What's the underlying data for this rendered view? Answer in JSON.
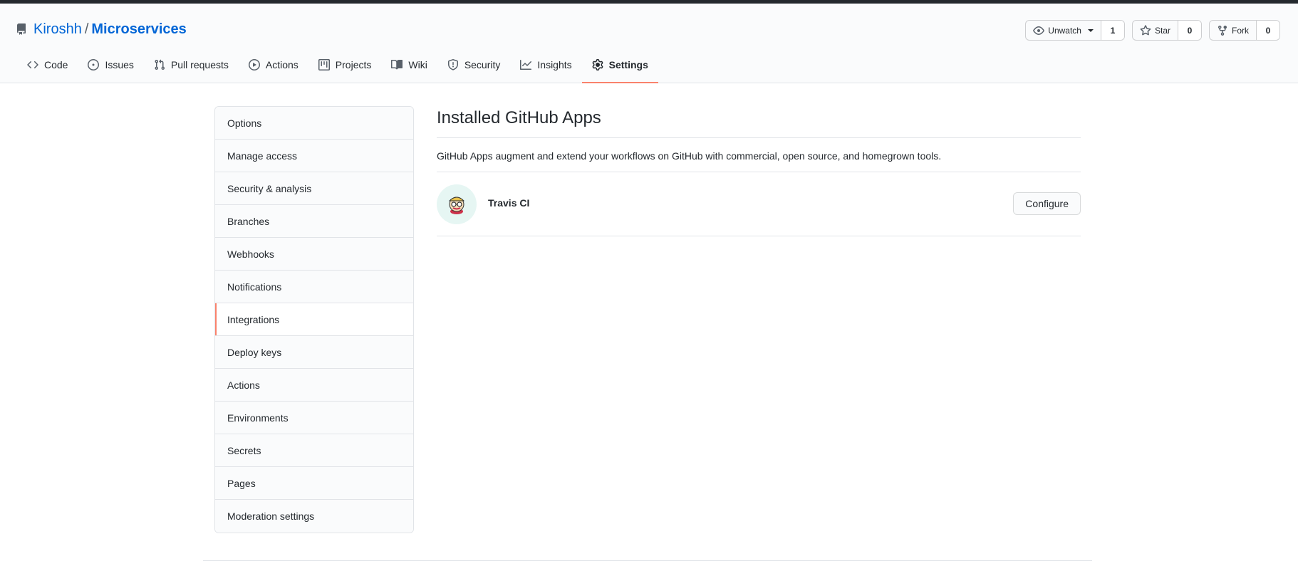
{
  "repo": {
    "owner": "Kiroshh",
    "separator": "/",
    "name": "Microservices"
  },
  "header_actions": {
    "watch": {
      "label": "Unwatch",
      "count": "1"
    },
    "star": {
      "label": "Star",
      "count": "0"
    },
    "fork": {
      "label": "Fork",
      "count": "0"
    }
  },
  "tabs": [
    {
      "label": "Code",
      "icon": "code-icon"
    },
    {
      "label": "Issues",
      "icon": "issue-icon"
    },
    {
      "label": "Pull requests",
      "icon": "pull-request-icon"
    },
    {
      "label": "Actions",
      "icon": "play-icon"
    },
    {
      "label": "Projects",
      "icon": "project-icon"
    },
    {
      "label": "Wiki",
      "icon": "book-icon"
    },
    {
      "label": "Security",
      "icon": "shield-icon"
    },
    {
      "label": "Insights",
      "icon": "graph-icon"
    },
    {
      "label": "Settings",
      "icon": "gear-icon",
      "selected": true
    }
  ],
  "menu": {
    "items": [
      {
        "label": "Options"
      },
      {
        "label": "Manage access"
      },
      {
        "label": "Security & analysis"
      },
      {
        "label": "Branches"
      },
      {
        "label": "Webhooks"
      },
      {
        "label": "Notifications"
      },
      {
        "label": "Integrations",
        "selected": true
      },
      {
        "label": "Deploy keys"
      },
      {
        "label": "Actions"
      },
      {
        "label": "Environments"
      },
      {
        "label": "Secrets"
      },
      {
        "label": "Pages"
      },
      {
        "label": "Moderation settings"
      }
    ]
  },
  "main": {
    "title": "Installed GitHub Apps",
    "description": "GitHub Apps augment and extend your workflows on GitHub with commercial, open source, and homegrown tools.",
    "apps": [
      {
        "name": "Travis CI",
        "button": "Configure"
      }
    ]
  },
  "colors": {
    "accent": "#f9826c",
    "link": "#0366d6",
    "topbar": "#24292e"
  }
}
